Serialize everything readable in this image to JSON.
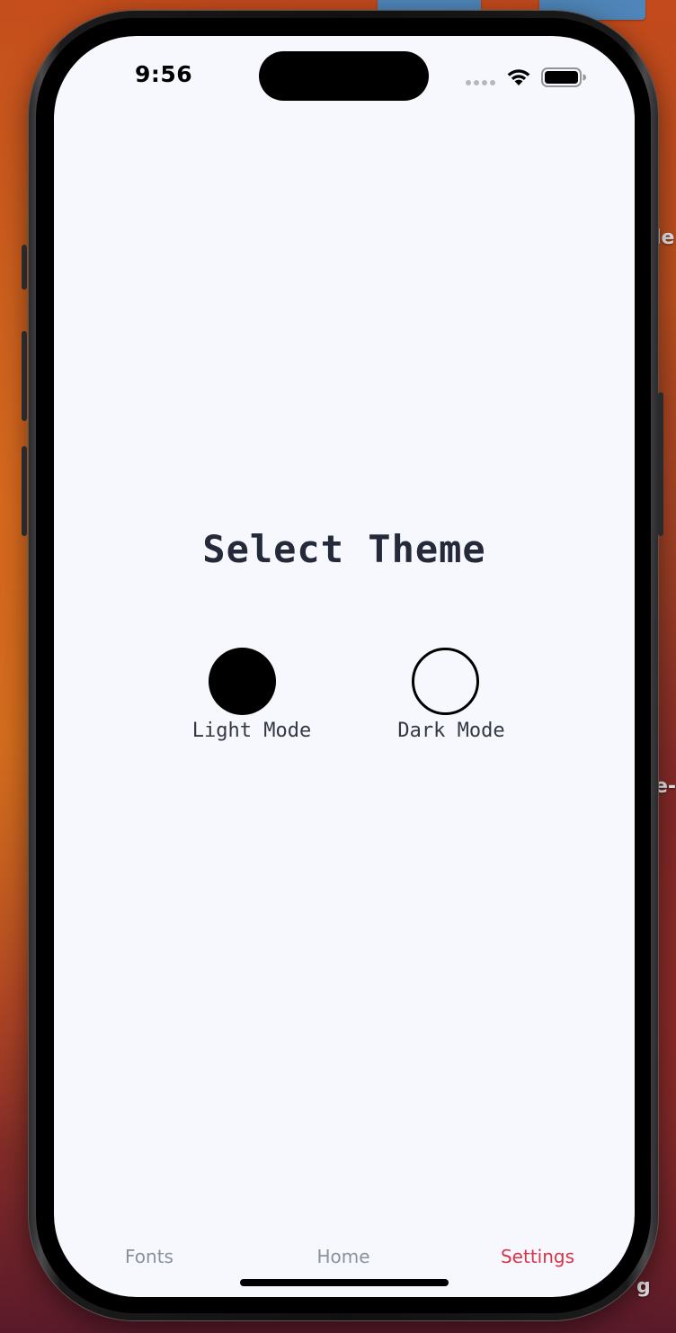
{
  "status_bar": {
    "time": "9:56"
  },
  "screen": {
    "title": "Select Theme",
    "options": [
      {
        "label": "Light Mode",
        "swatch_color": "#000000",
        "style": "filled"
      },
      {
        "label": "Dark Mode",
        "swatch_color": "#000000",
        "style": "outline"
      }
    ]
  },
  "tabbar": {
    "tabs": [
      {
        "label": "Fonts",
        "active": false
      },
      {
        "label": "Home",
        "active": false
      },
      {
        "label": "Settings",
        "active": true
      }
    ],
    "active_color": "#d73545",
    "inactive_color": "#8b919c"
  },
  "colors": {
    "screen_background": "#f7f8fd",
    "title_text": "#252a3a"
  },
  "desktop": {
    "edge_fragments": [
      "le",
      "e-",
      "g"
    ]
  }
}
